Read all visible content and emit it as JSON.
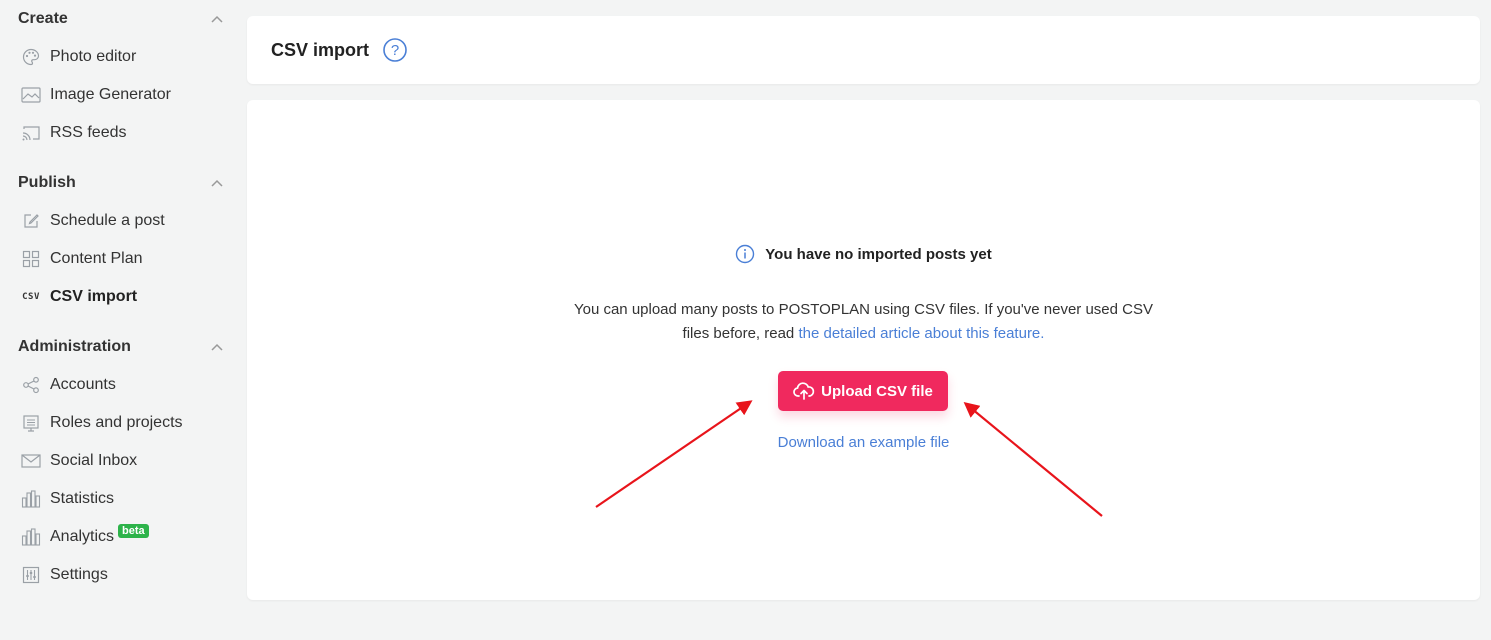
{
  "sidebar": {
    "sections": [
      {
        "title": "Create",
        "items": [
          {
            "label": "Photo editor",
            "icon": "palette-icon"
          },
          {
            "label": "Image Generator",
            "icon": "image-icon"
          },
          {
            "label": "RSS feeds",
            "icon": "rss-icon"
          }
        ]
      },
      {
        "title": "Publish",
        "items": [
          {
            "label": "Schedule a post",
            "icon": "edit-icon"
          },
          {
            "label": "Content Plan",
            "icon": "grid-icon"
          },
          {
            "label": "CSV import",
            "icon": "csv-icon",
            "glyph": "CSV",
            "active": true
          }
        ]
      },
      {
        "title": "Administration",
        "items": [
          {
            "label": "Accounts",
            "icon": "share-icon"
          },
          {
            "label": "Roles and projects",
            "icon": "presentation-icon"
          },
          {
            "label": "Social Inbox",
            "icon": "mail-icon"
          },
          {
            "label": "Statistics",
            "icon": "bar-chart-icon"
          },
          {
            "label": "Analytics",
            "icon": "bar-chart-icon",
            "badge": "beta"
          },
          {
            "label": "Settings",
            "icon": "sliders-icon"
          }
        ]
      }
    ]
  },
  "header": {
    "title": "CSV import",
    "help_symbol": "?"
  },
  "empty_state": {
    "title": "You have no imported posts yet",
    "description_line1": "You can upload many posts to POSTOPLAN using CSV files. If you've never used CSV",
    "description_line2_prefix": "files before, read ",
    "description_link": "the detailed article about this feature.",
    "upload_button": "Upload CSV file",
    "download_link": "Download an example file"
  },
  "colors": {
    "accent": "#f0295e",
    "link": "#4a7fd6",
    "badge": "#2db34a",
    "annotation_arrow": "#e8141b"
  }
}
